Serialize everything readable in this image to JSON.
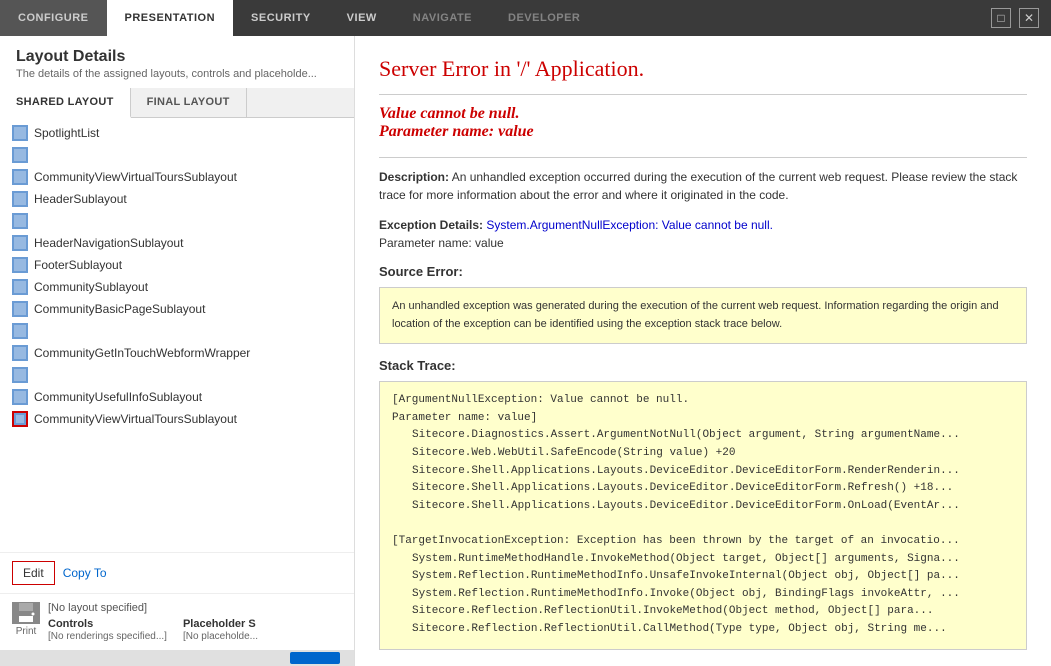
{
  "nav": {
    "tabs": [
      {
        "label": "CONFIGURE",
        "active": false
      },
      {
        "label": "PRESENTATION",
        "active": true
      },
      {
        "label": "SECURITY",
        "active": false
      },
      {
        "label": "VIEW",
        "active": false
      },
      {
        "label": "NAVIGATE",
        "active": false
      },
      {
        "label": "DEVELOPER",
        "active": false
      }
    ],
    "window_controls": {
      "maximize": "□",
      "close": "✕"
    }
  },
  "left_panel": {
    "header": {
      "title": "Layout Details",
      "subtitle": "The details of the assigned layouts, controls and placeholde..."
    },
    "tabs": [
      {
        "label": "SHARED LAYOUT",
        "active": true
      },
      {
        "label": "FINAL LAYOUT",
        "active": false
      }
    ],
    "layout_items": [
      {
        "name": "SpotlightList",
        "selected": false
      },
      {
        "name": "",
        "selected": false
      },
      {
        "name": "CommunityViewVirtualToursSublayout",
        "selected": false
      },
      {
        "name": "HeaderSublayout",
        "selected": false
      },
      {
        "name": "",
        "selected": false
      },
      {
        "name": "HeaderNavigationSublayout",
        "selected": false
      },
      {
        "name": "FooterSublayout",
        "selected": false
      },
      {
        "name": "CommunitySublayout",
        "selected": false
      },
      {
        "name": "CommunityBasicPageSublayout",
        "selected": false
      },
      {
        "name": "",
        "selected": false
      },
      {
        "name": "CommunityGetInTouchWebformWrapper",
        "selected": false
      },
      {
        "name": "",
        "selected": false
      },
      {
        "name": "CommunityUsefulInfoSublayout",
        "selected": false
      },
      {
        "name": "CommunityViewVirtualToursSublayout",
        "selected": true
      }
    ],
    "edit_copy_bar": {
      "edit_label": "Edit",
      "copy_to_label": "Copy To"
    },
    "bottom": {
      "no_layout": "[No layout specified]",
      "controls_label": "Controls",
      "controls_value": "[No renderings specified...]",
      "placeholder_label": "Placeholder S",
      "placeholder_value": "[No placeholde...",
      "print_label": "Print"
    }
  },
  "error_page": {
    "title": "Server Error in '/' Application.",
    "subtitle_line1": "Value cannot be null.",
    "subtitle_line2": "Parameter name: value",
    "description": "An unhandled exception occurred during the execution of the current web request. Please review the stack trace for more information about the error and where it originated in the code.",
    "exception_details_label": "Exception Details:",
    "exception_details_value": "System.ArgumentNullException: Value cannot be null.",
    "exception_param": "Parameter name: value",
    "source_error_label": "Source Error:",
    "source_error_text": "An unhandled exception was generated during the execution of the current web request. Information regarding the origin and location of the exception can be identified using the exception stack trace below.",
    "stack_trace_label": "Stack Trace:",
    "stack_trace_lines": [
      "[ArgumentNullException: Value cannot be null.",
      "Parameter name: value]",
      "    Sitecore.Diagnostics.Assert.ArgumentNotNull(Object argument, String argumentName...",
      "    Sitecore.Web.WebUtil.SafeEncode(String value) +20",
      "    Sitecore.Shell.Applications.Layouts.DeviceEditor.DeviceEditorForm.RenderRenderin...",
      "    Sitecore.Shell.Applications.Layouts.DeviceEditor.DeviceEditorForm.Refresh() +18...",
      "    Sitecore.Shell.Applications.Layouts.DeviceEditor.DeviceEditorForm.OnLoad(EventAr...",
      "",
      "[TargetInvocationException: Exception has been thrown by the target of an invocatio...",
      "    System.RuntimeMethodHandle.InvokeMethod(Object target, Object[] arguments, Signa...",
      "    System.Reflection.RuntimeMethodInfo.UnsafeInvokeInternal(Object obj, Object[] pa...",
      "    System.Reflection.RuntimeMethodInfo.Invoke(Object obj, BindingFlags invokeAttr, ...",
      "    Sitecore.Reflection.ReflectionUtil.InvokeMethod(Object method, Object[] para...",
      "    Sitecore.Reflection.ReflectionUtil.CallMethod(Type type, Object obj, String me..."
    ]
  }
}
